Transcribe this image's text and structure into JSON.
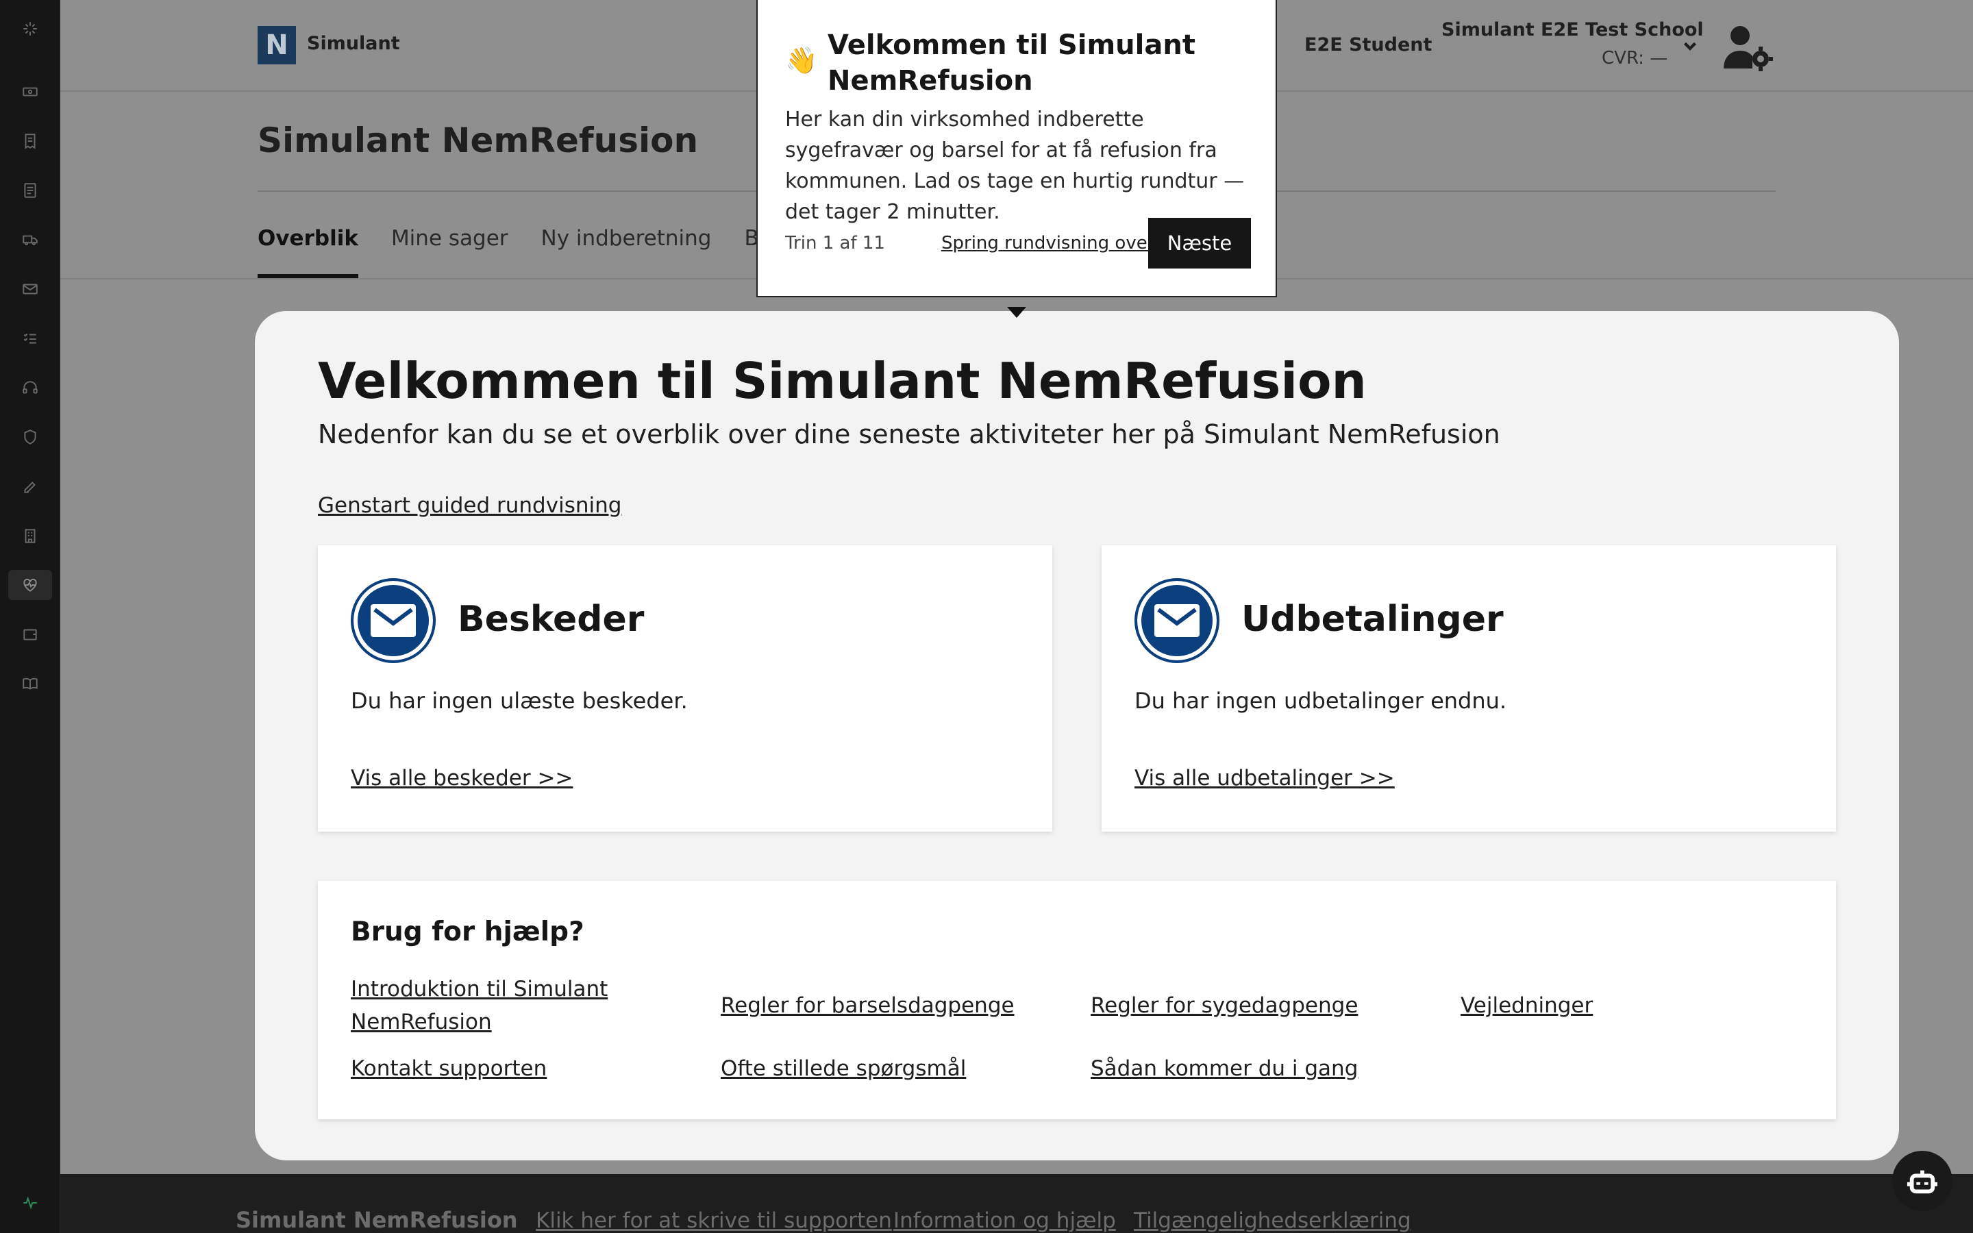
{
  "header": {
    "logo_letter": "N",
    "app_name": "Simulant",
    "user_name": "E2E Student",
    "school_name": "Simulant E2E Test School",
    "cvr": "CVR: —"
  },
  "page": {
    "title": "Simulant NemRefusion",
    "tabs": [
      {
        "label": "Overblik",
        "active": true
      },
      {
        "label": "Mine sager"
      },
      {
        "label": "Ny indberetning"
      },
      {
        "label": "Beske"
      }
    ]
  },
  "welcome": {
    "heading": "Velkommen til Simulant NemRefusion",
    "subheading": "Nedenfor kan du se et overblik over dine seneste aktiviteter her på Simulant NemRefusion",
    "restart_link": "Genstart guided rundvisning"
  },
  "cards": [
    {
      "title": "Beskeder",
      "text": "Du har ingen ulæste beskeder.",
      "link": "Vis alle beskeder >>",
      "icon": "mail-icon"
    },
    {
      "title": "Udbetalinger",
      "text": "Du har ingen udbetalinger endnu.",
      "link": "Vis alle udbetalinger >>",
      "icon": "mail-icon"
    }
  ],
  "help": {
    "title": "Brug for hjælp?",
    "links": [
      "Introduktion til Simulant NemRefusion",
      "Regler for barselsdagpenge",
      "Regler for sygedagpenge",
      "Vejledninger",
      "Kontakt supporten",
      "Ofte stillede spørgsmål",
      "Sådan kommer du i gang"
    ]
  },
  "footer": {
    "brand": "Simulant NemRefusion",
    "links": [
      "Klik her for at skrive til supporten",
      "Information og hjælp",
      "Tilgængelighedserklæring"
    ]
  },
  "tour": {
    "emoji": "👋",
    "title": "Velkommen til Simulant NemRefusion",
    "body": "Her kan din virksomhed indberette sygefravær og barsel for at få refusion fra kommunen. Lad os tage en hurtig rundtur — det tager 2 minutter.",
    "step": "Trin 1 af 11",
    "skip": "Spring rundvisning over",
    "next": "Næste"
  },
  "rail_icons": [
    "sparkle-icon",
    "cash-icon",
    "receipt-icon",
    "document-icon",
    "truck-icon",
    "mail-icon",
    "checklist-icon",
    "headset-icon",
    "shield-icon",
    "pen-icon",
    "building-icon",
    "heart-pulse-icon",
    "wallet-icon",
    "book-icon",
    "activity-icon"
  ],
  "colors": {
    "accent": "#0b3f7d",
    "brand_logo": "#1b3a5c",
    "overlay": "#8f8f8f",
    "rail": "#161616",
    "active_green": "#2d8c5a"
  }
}
